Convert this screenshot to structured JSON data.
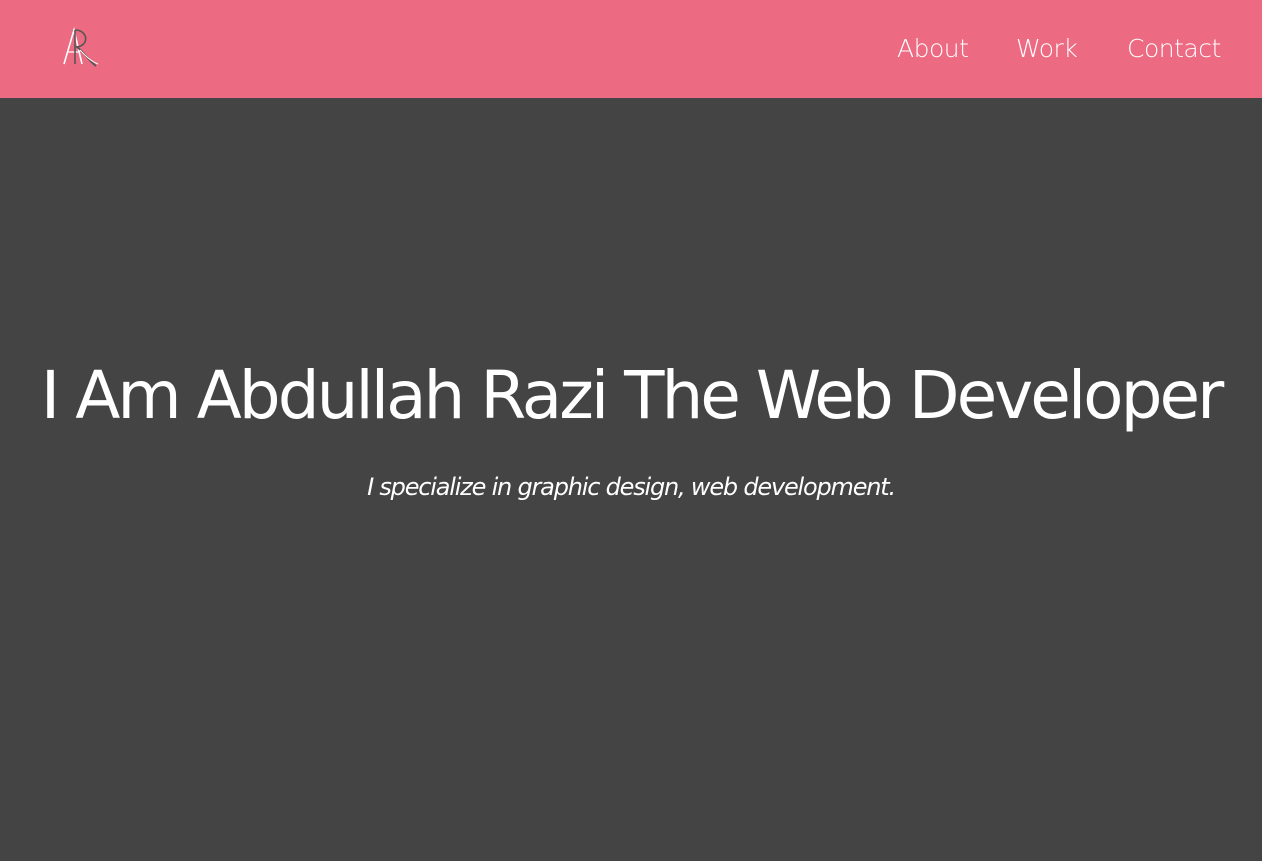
{
  "header": {
    "background_color": "#ed6b82",
    "logo_monogram": "AR",
    "nav": [
      {
        "label": "About"
      },
      {
        "label": "Work"
      },
      {
        "label": "Contact"
      }
    ]
  },
  "hero": {
    "background_color": "#444444",
    "title": "I Am Abdullah Razi The Web Developer",
    "subtitle": "I specialize in graphic design, web development."
  }
}
